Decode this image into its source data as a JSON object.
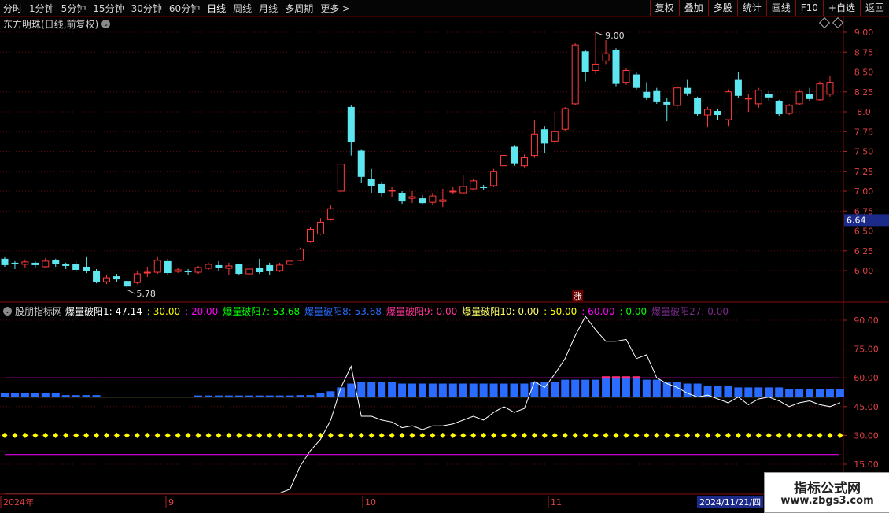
{
  "toolbar": {
    "periods": [
      "分时",
      "1分钟",
      "5分钟",
      "15分钟",
      "30分钟",
      "60分钟",
      "日线",
      "周线",
      "月线",
      "多周期",
      "更多"
    ],
    "active_period": "日线",
    "right_buttons": [
      "复权",
      "叠加",
      "多股",
      "统计",
      "画线",
      "F10",
      "+自选",
      "返回"
    ]
  },
  "kline_header": {
    "title": "东方明珠(日线,前复权)"
  },
  "price_panel": {
    "ticks": [
      "9.00",
      "8.75",
      "8.50",
      "8.25",
      "8.0",
      "7.75",
      "7.50",
      "7.25",
      "7.00",
      "6.75",
      "6.50",
      "6.25",
      "6.00"
    ],
    "current_price": "6.64",
    "low_label": "5.78",
    "high_label": "9.00",
    "event_marker": "涨"
  },
  "indicator_header": {
    "source": "股朋指标网",
    "items": [
      {
        "text": "爆量破阳1: 47.14",
        "color": "#ffffff"
      },
      {
        "text": ": 30.00",
        "color": "#ffff00"
      },
      {
        "text": ": 20.00",
        "color": "#ff00ff"
      },
      {
        "text": "爆量破阳7: 53.68",
        "color": "#00ff00"
      },
      {
        "text": "爆量破阳8: 53.68",
        "color": "#2a6cff"
      },
      {
        "text": "爆量破阳9: 0.00",
        "color": "#ff3399"
      },
      {
        "text": "爆量破阳10: 0.00",
        "color": "#ffff66"
      },
      {
        "text": ": 50.00",
        "color": "#ffff00"
      },
      {
        "text": ": 60.00",
        "color": "#ff00ff"
      },
      {
        "text": ": 0.00",
        "color": "#00ff00"
      },
      {
        "text": "爆量破阳27: 0.00",
        "color": "#7a2a8a"
      }
    ]
  },
  "indicator_panel": {
    "ticks": [
      "90.00",
      "75.00",
      "60.00",
      "45.00",
      "30.00",
      "15.00"
    ]
  },
  "date_axis": {
    "labels": [
      "2024年",
      "9",
      "10",
      "11"
    ],
    "cursor_date": "2024/11/21/四"
  },
  "watermark": {
    "line1": "指标公式网",
    "line2": "www.zbgs3.com"
  },
  "colors": {
    "up": "#ff3b3b",
    "down": "#5ee6f0",
    "border": "#8a0a0a"
  },
  "chart_data": [
    {
      "type": "candlestick",
      "title": "东方明珠(日线,前复权)",
      "ylim": [
        5.7,
        9.1
      ],
      "candles": [
        {
          "o": 6.15,
          "c": 6.07,
          "h": 6.18,
          "l": 6.05
        },
        {
          "o": 6.1,
          "c": 6.08,
          "h": 6.12,
          "l": 6.02
        },
        {
          "o": 6.08,
          "c": 6.11,
          "h": 6.14,
          "l": 6.03
        },
        {
          "o": 6.1,
          "c": 6.07,
          "h": 6.12,
          "l": 6.04
        },
        {
          "o": 6.05,
          "c": 6.12,
          "h": 6.16,
          "l": 6.03
        },
        {
          "o": 6.13,
          "c": 6.08,
          "h": 6.15,
          "l": 6.05
        },
        {
          "o": 6.08,
          "c": 6.06,
          "h": 6.1,
          "l": 6.02
        },
        {
          "o": 6.08,
          "c": 6.01,
          "h": 6.12,
          "l": 5.98
        },
        {
          "o": 6.05,
          "c": 6.0,
          "h": 6.18,
          "l": 5.97
        },
        {
          "o": 6.0,
          "c": 5.86,
          "h": 6.02,
          "l": 5.84
        },
        {
          "o": 5.86,
          "c": 5.91,
          "h": 5.94,
          "l": 5.83
        },
        {
          "o": 5.93,
          "c": 5.89,
          "h": 5.96,
          "l": 5.86
        },
        {
          "o": 5.87,
          "c": 5.8,
          "h": 5.89,
          "l": 5.78
        },
        {
          "o": 5.85,
          "c": 5.96,
          "h": 5.99,
          "l": 5.83
        },
        {
          "o": 5.97,
          "c": 5.98,
          "h": 6.05,
          "l": 5.92
        },
        {
          "o": 5.98,
          "c": 6.13,
          "h": 6.18,
          "l": 5.96
        },
        {
          "o": 6.12,
          "c": 5.97,
          "h": 6.15,
          "l": 5.94
        },
        {
          "o": 5.99,
          "c": 6.01,
          "h": 6.03,
          "l": 5.97
        },
        {
          "o": 6.0,
          "c": 5.98,
          "h": 6.02,
          "l": 5.95
        },
        {
          "o": 5.98,
          "c": 6.04,
          "h": 6.06,
          "l": 5.96
        },
        {
          "o": 6.03,
          "c": 6.08,
          "h": 6.1,
          "l": 6.01
        },
        {
          "o": 6.07,
          "c": 6.04,
          "h": 6.12,
          "l": 6.0
        },
        {
          "o": 6.03,
          "c": 6.06,
          "h": 6.1,
          "l": 5.95
        },
        {
          "o": 6.08,
          "c": 5.96,
          "h": 6.09,
          "l": 5.94
        },
        {
          "o": 5.96,
          "c": 6.02,
          "h": 6.04,
          "l": 5.94
        },
        {
          "o": 6.04,
          "c": 5.98,
          "h": 6.15,
          "l": 5.96
        },
        {
          "o": 6.07,
          "c": 6.0,
          "h": 6.1,
          "l": 5.95
        },
        {
          "o": 6.0,
          "c": 6.07,
          "h": 6.1,
          "l": 5.98
        },
        {
          "o": 6.08,
          "c": 6.12,
          "h": 6.14,
          "l": 6.06
        },
        {
          "o": 6.13,
          "c": 6.27,
          "h": 6.29,
          "l": 6.12
        },
        {
          "o": 6.37,
          "c": 6.52,
          "h": 6.55,
          "l": 6.35
        },
        {
          "o": 6.46,
          "c": 6.61,
          "h": 6.66,
          "l": 6.45
        },
        {
          "o": 6.65,
          "c": 6.78,
          "h": 6.82,
          "l": 6.63
        },
        {
          "o": 7.0,
          "c": 7.34,
          "h": 7.36,
          "l": 6.98
        },
        {
          "o": 8.06,
          "c": 7.62,
          "h": 8.08,
          "l": 7.45
        },
        {
          "o": 7.51,
          "c": 7.18,
          "h": 7.52,
          "l": 7.1
        },
        {
          "o": 7.15,
          "c": 7.06,
          "h": 7.28,
          "l": 6.98
        },
        {
          "o": 7.09,
          "c": 6.98,
          "h": 7.12,
          "l": 6.93
        },
        {
          "o": 7.0,
          "c": 7.01,
          "h": 7.05,
          "l": 6.92
        },
        {
          "o": 6.98,
          "c": 6.87,
          "h": 7.0,
          "l": 6.84
        },
        {
          "o": 6.91,
          "c": 6.93,
          "h": 7.0,
          "l": 6.85
        },
        {
          "o": 6.91,
          "c": 6.85,
          "h": 6.95,
          "l": 6.84
        },
        {
          "o": 6.86,
          "c": 6.94,
          "h": 6.98,
          "l": 6.83
        },
        {
          "o": 6.87,
          "c": 6.89,
          "h": 7.03,
          "l": 6.8
        },
        {
          "o": 6.99,
          "c": 7.0,
          "h": 7.05,
          "l": 6.96
        },
        {
          "o": 6.98,
          "c": 7.06,
          "h": 7.2,
          "l": 6.96
        },
        {
          "o": 7.03,
          "c": 7.13,
          "h": 7.16,
          "l": 7.01
        },
        {
          "o": 7.05,
          "c": 7.04,
          "h": 7.08,
          "l": 7.02
        },
        {
          "o": 7.07,
          "c": 7.25,
          "h": 7.28,
          "l": 7.05
        },
        {
          "o": 7.32,
          "c": 7.45,
          "h": 7.5,
          "l": 7.3
        },
        {
          "o": 7.56,
          "c": 7.35,
          "h": 7.58,
          "l": 7.32
        },
        {
          "o": 7.32,
          "c": 7.42,
          "h": 7.46,
          "l": 7.3
        },
        {
          "o": 7.45,
          "c": 7.72,
          "h": 7.9,
          "l": 7.42
        },
        {
          "o": 7.78,
          "c": 7.6,
          "h": 7.82,
          "l": 7.48
        },
        {
          "o": 7.63,
          "c": 7.75,
          "h": 8.0,
          "l": 7.6
        },
        {
          "o": 7.78,
          "c": 8.04,
          "h": 8.06,
          "l": 7.76
        },
        {
          "o": 8.1,
          "c": 8.84,
          "h": 8.86,
          "l": 8.08
        },
        {
          "o": 8.76,
          "c": 8.5,
          "h": 8.78,
          "l": 8.38
        },
        {
          "o": 8.52,
          "c": 8.6,
          "h": 9.0,
          "l": 8.48
        },
        {
          "o": 8.64,
          "c": 8.73,
          "h": 8.9,
          "l": 8.6
        },
        {
          "o": 8.78,
          "c": 8.35,
          "h": 8.8,
          "l": 8.32
        },
        {
          "o": 8.37,
          "c": 8.52,
          "h": 8.55,
          "l": 8.34
        },
        {
          "o": 8.47,
          "c": 8.3,
          "h": 8.5,
          "l": 8.27
        },
        {
          "o": 8.25,
          "c": 8.18,
          "h": 8.37,
          "l": 8.15
        },
        {
          "o": 8.26,
          "c": 8.12,
          "h": 8.3,
          "l": 8.1
        },
        {
          "o": 8.12,
          "c": 8.09,
          "h": 8.17,
          "l": 7.88
        },
        {
          "o": 8.08,
          "c": 8.3,
          "h": 8.33,
          "l": 8.03
        },
        {
          "o": 8.3,
          "c": 8.23,
          "h": 8.4,
          "l": 8.2
        },
        {
          "o": 8.17,
          "c": 7.97,
          "h": 8.19,
          "l": 7.95
        },
        {
          "o": 7.96,
          "c": 8.03,
          "h": 8.06,
          "l": 7.8
        },
        {
          "o": 8.01,
          "c": 7.96,
          "h": 8.04,
          "l": 7.9
        },
        {
          "o": 7.9,
          "c": 8.25,
          "h": 8.28,
          "l": 7.82
        },
        {
          "o": 8.4,
          "c": 8.2,
          "h": 8.5,
          "l": 8.17
        },
        {
          "o": 8.16,
          "c": 8.17,
          "h": 8.22,
          "l": 8.0
        },
        {
          "o": 8.1,
          "c": 8.27,
          "h": 8.3,
          "l": 8.05
        },
        {
          "o": 8.22,
          "c": 8.18,
          "h": 8.26,
          "l": 8.14
        },
        {
          "o": 8.13,
          "c": 7.97,
          "h": 8.15,
          "l": 7.94
        },
        {
          "o": 7.98,
          "c": 8.08,
          "h": 8.1,
          "l": 7.96
        },
        {
          "o": 8.1,
          "c": 8.25,
          "h": 8.28,
          "l": 8.08
        },
        {
          "o": 8.22,
          "c": 8.16,
          "h": 8.3,
          "l": 8.13
        },
        {
          "o": 8.15,
          "c": 8.35,
          "h": 8.38,
          "l": 8.13
        },
        {
          "o": 8.22,
          "c": 8.37,
          "h": 8.45,
          "l": 8.19
        }
      ]
    },
    {
      "type": "line",
      "title": "股朋指标网",
      "ylim": [
        0,
        100
      ],
      "hlines": [
        {
          "value": 60,
          "color": "#ff00ff"
        },
        {
          "value": 50,
          "color": "#ffff66"
        },
        {
          "value": 30,
          "color": "#ffff00",
          "style": "dots"
        },
        {
          "value": 20,
          "color": "#ff00ff"
        }
      ],
      "bars_white_line": [
        0,
        0,
        0,
        0,
        0,
        0,
        0,
        0,
        0,
        0,
        0,
        0,
        0,
        0,
        0,
        0,
        0,
        0,
        0,
        0,
        0,
        0,
        0,
        0,
        0,
        0,
        0,
        0,
        2,
        14,
        22,
        28,
        38,
        55,
        66,
        40,
        40,
        38,
        37,
        34,
        35,
        33,
        35,
        35,
        36,
        38,
        40,
        38,
        42,
        45,
        42,
        44,
        58,
        55,
        62,
        70,
        82,
        92,
        85,
        79,
        79,
        80,
        70,
        72,
        60,
        57,
        55,
        52,
        50,
        51,
        49,
        47,
        50,
        46,
        49,
        50,
        48,
        45,
        47,
        48,
        46,
        45,
        47
      ],
      "series": [
        {
          "name": "爆量破阳7",
          "color": "#2a6cff",
          "values": [
            52,
            52,
            52,
            52,
            52,
            52,
            51,
            51,
            51,
            51,
            0,
            0,
            0,
            0,
            0,
            0,
            0,
            0,
            0,
            50,
            50,
            50,
            50,
            50,
            50,
            50,
            50,
            50,
            50,
            51,
            51,
            52,
            53,
            55,
            57,
            58,
            58,
            58,
            58,
            57,
            57,
            57,
            57,
            57,
            57,
            57,
            57,
            57,
            57,
            57,
            57,
            57,
            58,
            58,
            58,
            59,
            59,
            59,
            59,
            60,
            60,
            60,
            60,
            59,
            59,
            58,
            58,
            57,
            57,
            56,
            56,
            56,
            55,
            55,
            55,
            55,
            55,
            54,
            54,
            54,
            54,
            54,
            54
          ]
        }
      ]
    }
  ]
}
